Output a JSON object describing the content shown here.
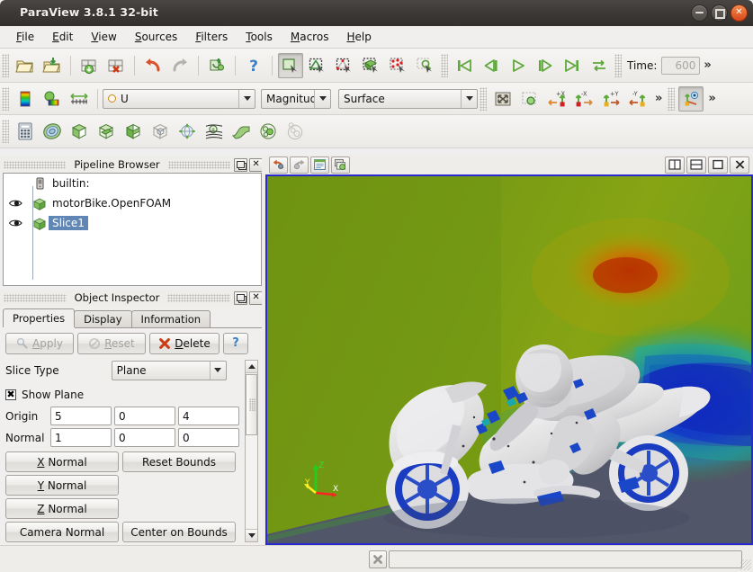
{
  "window": {
    "title": "ParaView 3.8.1 32-bit",
    "controls": {
      "minimize": "minimize-button",
      "maximize": "maximize-button",
      "close": "close-button"
    }
  },
  "menu": {
    "items": [
      {
        "label": "File",
        "mnemonic": "F"
      },
      {
        "label": "Edit",
        "mnemonic": "E"
      },
      {
        "label": "View",
        "mnemonic": "V"
      },
      {
        "label": "Sources",
        "mnemonic": "S"
      },
      {
        "label": "Filters",
        "mnemonic": "F"
      },
      {
        "label": "Tools",
        "mnemonic": "T"
      },
      {
        "label": "Macros",
        "mnemonic": "M"
      },
      {
        "label": "Help",
        "mnemonic": "H"
      }
    ]
  },
  "toolbar_main": {
    "buttons": [
      {
        "name": "open-file-icon",
        "tooltip": "Open"
      },
      {
        "name": "open-recent-icon",
        "tooltip": "Open Recent"
      },
      {
        "name": "save-data-icon",
        "tooltip": "Save Data"
      },
      {
        "name": "save-screenshot-icon",
        "tooltip": "Save Screenshot"
      },
      {
        "name": "undo-icon",
        "tooltip": "Undo"
      },
      {
        "name": "redo-icon",
        "tooltip": "Redo"
      },
      {
        "name": "connect-icon",
        "tooltip": "Connect"
      },
      {
        "name": "help-icon",
        "tooltip": "Help"
      }
    ],
    "selection_buttons": [
      {
        "name": "select-cells-icon",
        "tooltip": "Select Cells On",
        "pressed": true
      },
      {
        "name": "select-points-icon",
        "tooltip": "Select Points On",
        "pressed": false
      },
      {
        "name": "select-points-through-icon",
        "tooltip": "Select Points Through",
        "pressed": false
      },
      {
        "name": "select-cells-through-icon",
        "tooltip": "Select Cells Through",
        "pressed": false
      },
      {
        "name": "select-block-icon",
        "tooltip": "Select Block",
        "pressed": false
      },
      {
        "name": "zoom-to-box-icon",
        "tooltip": "Zoom to Box",
        "pressed": false
      }
    ],
    "vcr": [
      {
        "name": "first-frame-button",
        "glyph": "first"
      },
      {
        "name": "previous-frame-button",
        "glyph": "prev"
      },
      {
        "name": "play-button",
        "glyph": "play"
      },
      {
        "name": "next-frame-button",
        "glyph": "next"
      },
      {
        "name": "last-frame-button",
        "glyph": "last"
      },
      {
        "name": "loop-button",
        "glyph": "loop"
      }
    ],
    "time_label": "Time:",
    "time_value": "600",
    "overflow": "»"
  },
  "toolbar_color": {
    "buttons": [
      {
        "name": "edit-color-map-icon",
        "tooltip": "Edit Color Map"
      },
      {
        "name": "rescale-to-data-range-icon",
        "tooltip": "Rescale to Data Range"
      },
      {
        "name": "rescale-custom-range-icon",
        "tooltip": "Rescale to Custom Range"
      }
    ],
    "array": {
      "label": "U",
      "kind": "point-data"
    },
    "component": "Magnitude",
    "representation": "Surface",
    "camera_buttons": [
      {
        "name": "reset-camera-icon",
        "tooltip": "Reset Camera"
      },
      {
        "name": "zoom-to-data-icon",
        "tooltip": "Zoom To Data"
      },
      {
        "name": "set-view-plus-x-icon",
        "label": "+X"
      },
      {
        "name": "set-view-minus-x-icon",
        "label": "-X"
      },
      {
        "name": "set-view-plus-y-icon",
        "label": "+Y"
      },
      {
        "name": "set-view-minus-y-icon",
        "label": "-Y"
      }
    ],
    "center-axes-visibility": {
      "name": "show-center-axes-icon",
      "pressed": true
    },
    "overflow": "»"
  },
  "toolbar_filters": {
    "buttons": [
      {
        "name": "calculator-filter-icon",
        "tooltip": "Calculator"
      },
      {
        "name": "contour-filter-icon",
        "tooltip": "Contour"
      },
      {
        "name": "clip-filter-icon",
        "tooltip": "Clip"
      },
      {
        "name": "slice-filter-icon",
        "tooltip": "Slice"
      },
      {
        "name": "threshold-filter-icon",
        "tooltip": "Threshold"
      },
      {
        "name": "extract-subset-filter-icon",
        "tooltip": "Extract Subset"
      },
      {
        "name": "glyph-filter-icon",
        "tooltip": "Glyph"
      },
      {
        "name": "stream-tracer-filter-icon",
        "tooltip": "Stream Tracer"
      },
      {
        "name": "warp-filter-icon",
        "tooltip": "Warp By Vector"
      },
      {
        "name": "group-datasets-filter-icon",
        "tooltip": "Group Datasets"
      },
      {
        "name": "extract-level-filter-icon",
        "tooltip": "Extract Level"
      }
    ]
  },
  "pipeline_browser": {
    "title": "Pipeline Browser",
    "items": [
      {
        "label": "builtin:",
        "type": "server",
        "visible": null,
        "selected": false
      },
      {
        "label": "motorBike.OpenFOAM",
        "type": "reader",
        "visible": true,
        "selected": false
      },
      {
        "label": "Slice1",
        "type": "filter",
        "visible": true,
        "selected": true
      }
    ],
    "float_button": "undock",
    "close_button": "close"
  },
  "object_inspector": {
    "title": "Object Inspector",
    "tabs": [
      {
        "label": "Properties",
        "active": true
      },
      {
        "label": "Display",
        "active": false
      },
      {
        "label": "Information",
        "active": false
      }
    ],
    "actions": [
      {
        "label": "Apply",
        "mnemonic": "A",
        "name": "apply-button",
        "enabled": false
      },
      {
        "label": "Reset",
        "mnemonic": "R",
        "name": "reset-button",
        "enabled": false
      },
      {
        "label": "Delete",
        "mnemonic": "D",
        "name": "delete-button",
        "enabled": true
      },
      {
        "label": "?",
        "name": "help-button",
        "enabled": true
      }
    ],
    "properties": {
      "slice_type_label": "Slice Type",
      "slice_type_value": "Plane",
      "show_plane_label": "Show Plane",
      "show_plane_checked": true,
      "origin_label": "Origin",
      "origin": [
        "5",
        "0",
        "4"
      ],
      "normal_label": "Normal",
      "normal": [
        "1",
        "0",
        "0"
      ],
      "buttons": [
        {
          "label": "X Normal",
          "mnemonic": "X",
          "name": "x-normal-button"
        },
        {
          "label": "Reset Bounds",
          "name": "reset-bounds-button"
        },
        {
          "label": "Y Normal",
          "mnemonic": "Y",
          "name": "y-normal-button"
        },
        {
          "label": "",
          "name": "spacer"
        },
        {
          "label": "Z Normal",
          "mnemonic": "Z",
          "name": "z-normal-button"
        },
        {
          "label": "",
          "name": "spacer2"
        },
        {
          "label": "Camera Normal",
          "name": "camera-normal-button"
        },
        {
          "label": "Center on Bounds",
          "name": "center-on-bounds-button"
        }
      ]
    }
  },
  "render_view": {
    "toolbar_left": [
      {
        "name": "undo-camera-icon",
        "tooltip": "Undo Camera"
      },
      {
        "name": "redo-camera-icon",
        "tooltip": "Redo Camera"
      },
      {
        "name": "toggle-color-legend-icon",
        "tooltip": "Toggle Color Legend"
      },
      {
        "name": "capture-screenshot-icon",
        "tooltip": "Capture Screenshot"
      }
    ],
    "toolbar_right": [
      {
        "name": "split-horizontal-button",
        "tooltip": "Split Horizontal"
      },
      {
        "name": "split-vertical-button",
        "tooltip": "Split Vertical"
      },
      {
        "name": "maximize-view-button",
        "tooltip": "Maximize"
      },
      {
        "name": "close-view-button",
        "tooltip": "Close"
      }
    ],
    "scene": {
      "description": "OpenFOAM motorBike slice colored by velocity magnitude",
      "background_top": "#7b9a16",
      "ground_color": "#525669",
      "geometry_color": "#e3e3e5",
      "border_color": "#2a2ad0",
      "colormap": [
        "#0000bf",
        "#00c0c0",
        "#5fbf00",
        "#8fa000",
        "#d06000",
        "#bf0000"
      ],
      "axes": [
        {
          "label": "X",
          "color": "#ff2020"
        },
        {
          "label": "Y",
          "color": "#ffff20"
        },
        {
          "label": "Z",
          "color": "#20ff20"
        }
      ]
    }
  },
  "status_bar": {
    "cancel_button": "cancel-button",
    "progress_text": ""
  }
}
